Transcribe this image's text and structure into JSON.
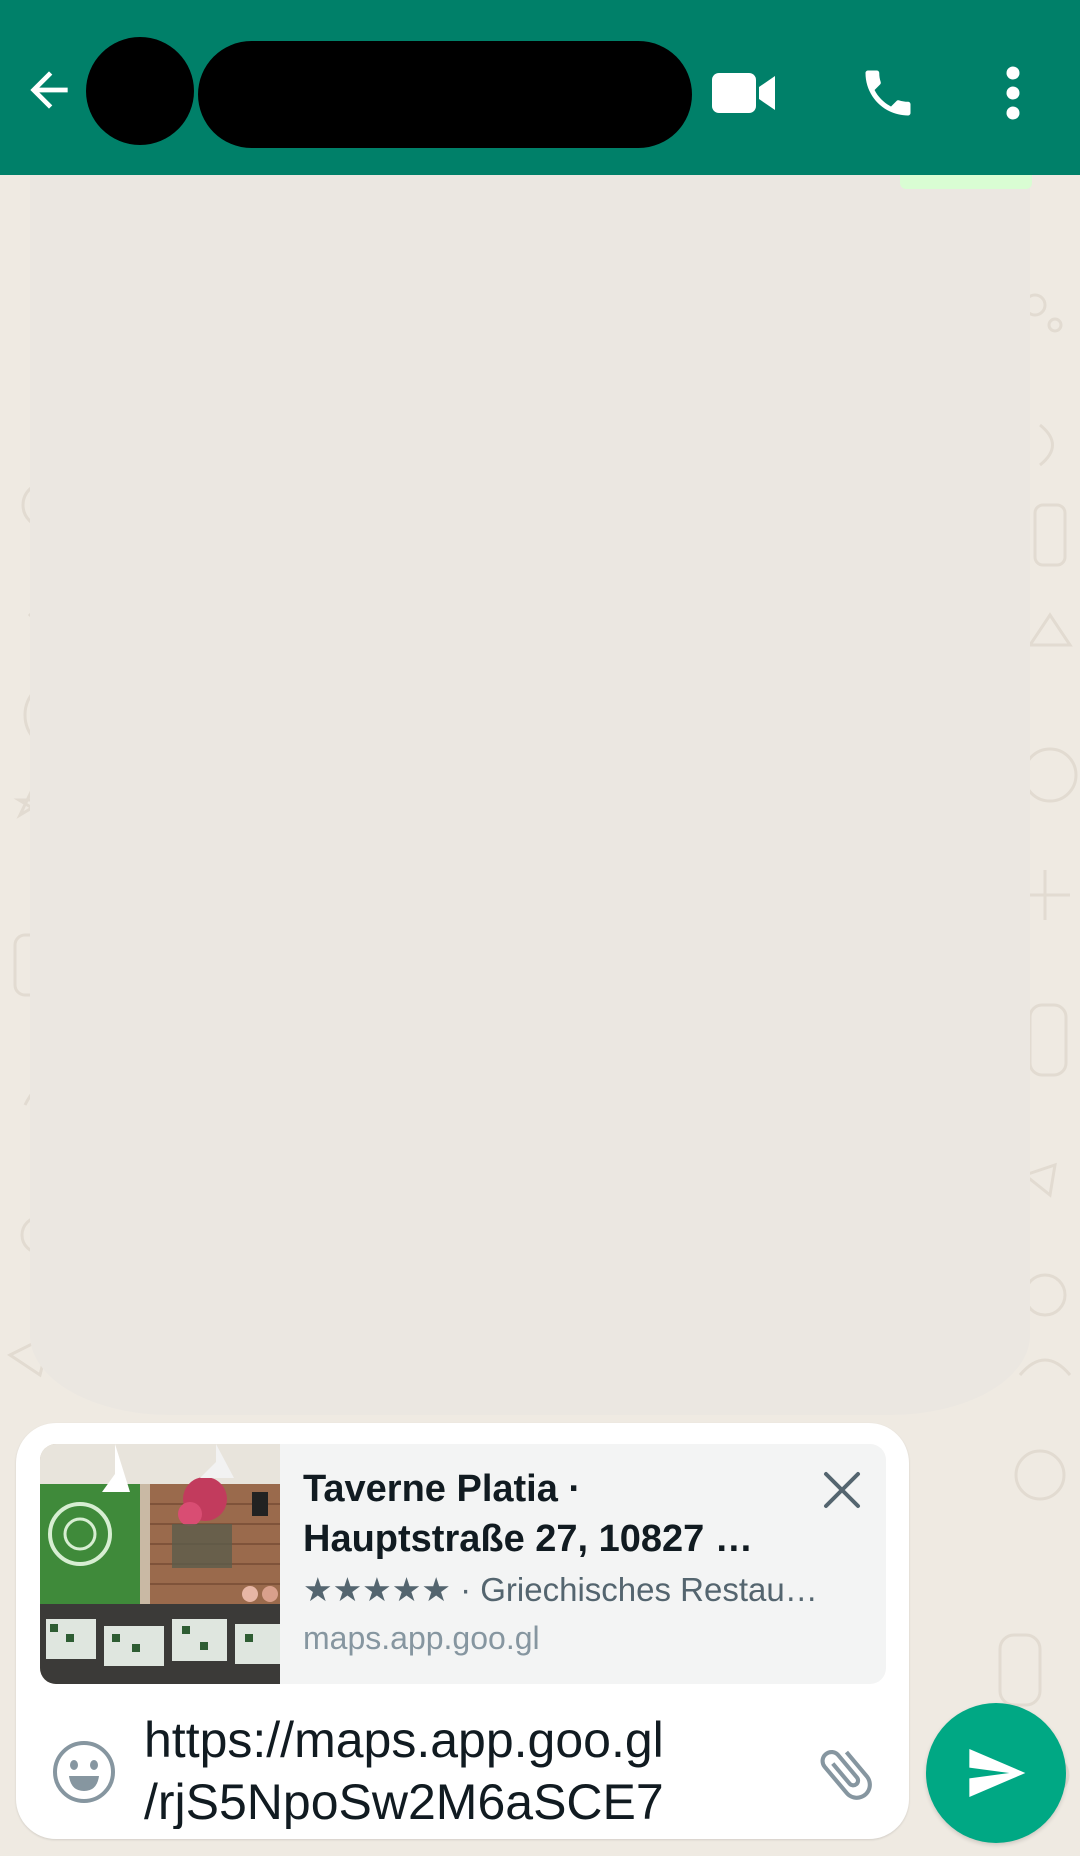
{
  "colors": {
    "header": "#008069",
    "chat_background": "#efeae2",
    "send_button": "#00a884",
    "outgoing_bubble": "#d9fdd3"
  },
  "header": {
    "contact_name": "",
    "icons": [
      "back-arrow-icon",
      "video-call-icon",
      "voice-call-icon",
      "more-options-icon"
    ]
  },
  "link_preview": {
    "title": "Taverne Platia ·\nHauptstraße 27, 10827 …",
    "description": "★★★★★ · Griechisches Restau…",
    "domain": "maps.app.goo.gl",
    "close_icon": "close-icon"
  },
  "composer": {
    "message_value": "https://maps.app.goo.gl\n/rjS5NpoSw2M6aSCE7",
    "emoji_icon": "emoji-icon",
    "attach_icon": "paperclip-icon"
  },
  "send_button": {
    "icon": "send-icon"
  }
}
